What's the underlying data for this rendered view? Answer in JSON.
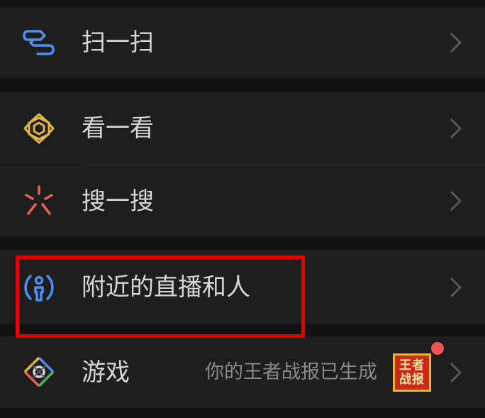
{
  "menu": {
    "scan": {
      "label": "扫一扫",
      "icon": "scan-icon"
    },
    "look": {
      "label": "看一看",
      "icon": "look-icon"
    },
    "search": {
      "label": "搜一搜",
      "icon": "search-icon"
    },
    "nearby_live": {
      "label": "附近的直播和人",
      "icon": "nearby-live-icon"
    },
    "games": {
      "label": "游戏",
      "icon": "games-icon",
      "subtitle": "你的王者战报已生成",
      "thumbnail_text": "王者战报",
      "has_notification_badge": true
    }
  },
  "colors": {
    "background": "#111111",
    "row_background": "#1e1e1e",
    "text": "#d6d6d6",
    "subtext": "#8a8a8a",
    "highlight": "#e10000",
    "badge": "#f05454"
  }
}
